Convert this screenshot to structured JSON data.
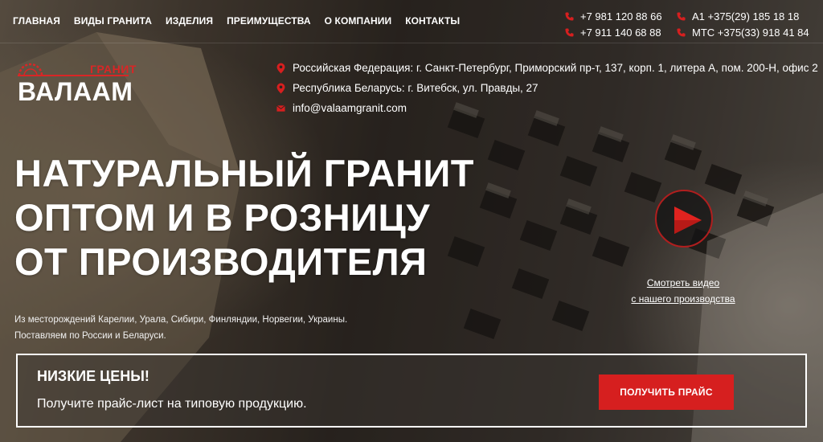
{
  "nav": {
    "items": [
      "ГЛАВНАЯ",
      "ВИДЫ ГРАНИТА",
      "ИЗДЕЛИЯ",
      "ПРЕИМУЩЕСТВА",
      "О КОМПАНИИ",
      "КОНТАКТЫ"
    ]
  },
  "phones": {
    "ru": [
      "+7 981 120 88 66",
      "+7 911 140 68 88"
    ],
    "by": [
      "А1 +375(29) 185 18 18",
      "МТС +375(33) 918 41 84"
    ]
  },
  "logo": {
    "small": "ГРАНИТ",
    "big": "ВАЛААМ"
  },
  "contacts": {
    "address_ru": "Российская Федерация: г. Санкт-Петербург, Приморский пр-т, 137, корп. 1, литера А, пом. 200-Н, офис 2",
    "address_by": "Республика Беларусь: г. Витебск, ул. Правды, 27",
    "email": "info@valaamgranit.com"
  },
  "hero": {
    "headline": [
      "НАТУРАЛЬНЫЙ ГРАНИТ",
      "ОПТОМ И В РОЗНИЦУ",
      "ОТ ПРОИЗВОДИТЕЛЯ"
    ],
    "subtext": [
      "Из месторождений Карелии, Урала, Сибири, Финляндии, Норвегии, Украины.",
      "Поставляем по России и Беларуси."
    ]
  },
  "video": {
    "link_lines": [
      "Смотреть видео",
      "с нашего производства"
    ]
  },
  "price": {
    "title": "НИЗКИЕ ЦЕНЫ!",
    "text": "Получите прайс-лист на типовую продукцию.",
    "button": "ПОЛУЧИТЬ ПРАЙС"
  },
  "colors": {
    "accent": "#d61f1f"
  },
  "icons": {
    "phone": "phone-icon",
    "pin": "location-pin-icon",
    "mail": "mail-icon",
    "play": "play-icon",
    "logo": "saw-gear-icon"
  }
}
